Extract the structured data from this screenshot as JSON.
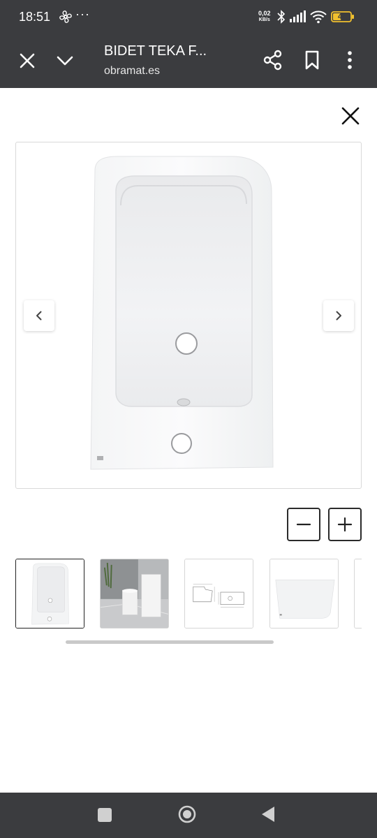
{
  "status_bar": {
    "time": "18:51",
    "more": "···",
    "net_speed_value": "0,02",
    "net_speed_unit": "KB/s",
    "battery_level": "47",
    "battery_color": "#f2c12e"
  },
  "app_bar": {
    "title": "BIDET TEKA F...",
    "domain": "obramat.es"
  },
  "gallery": {
    "current_image": "bidet-top-view",
    "thumbnails": [
      {
        "name": "bidet-top-view",
        "selected": true
      },
      {
        "name": "bathroom-scene",
        "selected": false
      },
      {
        "name": "technical-drawing",
        "selected": false
      },
      {
        "name": "bidet-side-view",
        "selected": false
      },
      {
        "name": "partial-thumbnail",
        "selected": false
      }
    ]
  },
  "icons": {
    "close": "close-icon",
    "chevron": "chevron-down-icon",
    "share": "share-icon",
    "bookmark": "bookmark-icon",
    "more": "more-vert-icon",
    "prev": "chevron-left-icon",
    "next": "chevron-right-icon",
    "zoom_out": "minus-icon",
    "zoom_in": "plus-icon"
  },
  "colors": {
    "chrome": "#3b3c3f",
    "border": "#d9d9d9",
    "scrollbar": "#c9c9c9"
  }
}
